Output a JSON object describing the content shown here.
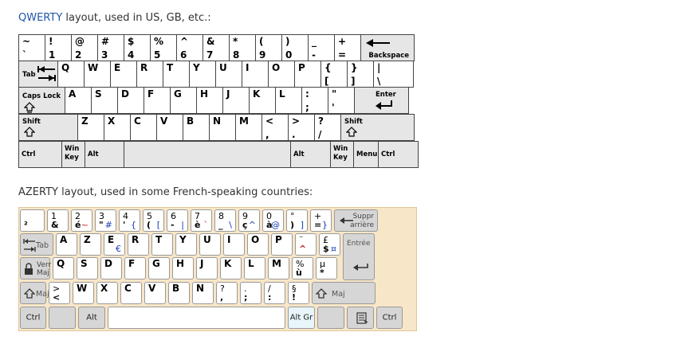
{
  "qwerty": {
    "heading_prefix": "QWERTY",
    "heading_rest": " layout, used in US, GB, etc.:",
    "rows": [
      [
        {
          "top": "~",
          "bottom": "`"
        },
        {
          "top": "!",
          "bottom": "1"
        },
        {
          "top": "@",
          "bottom": "2"
        },
        {
          "top": "#",
          "bottom": "3"
        },
        {
          "top": "$",
          "bottom": "4"
        },
        {
          "top": "%",
          "bottom": "5"
        },
        {
          "top": "^",
          "bottom": "6"
        },
        {
          "top": "&",
          "bottom": "7"
        },
        {
          "top": "*",
          "bottom": "8"
        },
        {
          "top": "(",
          "bottom": "9"
        },
        {
          "top": ")",
          "bottom": "0"
        },
        {
          "top": "_",
          "bottom": "-"
        },
        {
          "top": "+",
          "bottom": "="
        },
        {
          "label": "Backspace"
        }
      ],
      [
        {
          "label": "Tab"
        },
        {
          "main": "Q"
        },
        {
          "main": "W"
        },
        {
          "main": "E"
        },
        {
          "main": "R"
        },
        {
          "main": "T"
        },
        {
          "main": "Y"
        },
        {
          "main": "U"
        },
        {
          "main": "I"
        },
        {
          "main": "O"
        },
        {
          "main": "P"
        },
        {
          "top": "{",
          "bottom": "["
        },
        {
          "top": "}",
          "bottom": "]"
        },
        {
          "top": "|",
          "bottom": "\\"
        }
      ],
      [
        {
          "label": "Caps Lock"
        },
        {
          "main": "A"
        },
        {
          "main": "S"
        },
        {
          "main": "D"
        },
        {
          "main": "F"
        },
        {
          "main": "G"
        },
        {
          "main": "H"
        },
        {
          "main": "J"
        },
        {
          "main": "K"
        },
        {
          "main": "L"
        },
        {
          "top": ":",
          "bottom": ";"
        },
        {
          "top": "\"",
          "bottom": "'"
        },
        {
          "label": "Enter"
        }
      ],
      [
        {
          "label": "Shift"
        },
        {
          "main": "Z"
        },
        {
          "main": "X"
        },
        {
          "main": "C"
        },
        {
          "main": "V"
        },
        {
          "main": "B"
        },
        {
          "main": "N"
        },
        {
          "main": "M"
        },
        {
          "top": "<",
          "bottom": ","
        },
        {
          "top": ">",
          "bottom": "."
        },
        {
          "top": "?",
          "bottom": "/"
        },
        {
          "label": "Shift"
        }
      ],
      [
        {
          "label": "Ctrl"
        },
        {
          "label": "Win Key"
        },
        {
          "label": "Alt"
        },
        {
          "label": ""
        },
        {
          "label": "Alt"
        },
        {
          "label": "Win Key"
        },
        {
          "label": "Menu"
        },
        {
          "label": "Ctrl"
        }
      ]
    ]
  },
  "azerty": {
    "heading": "AZERTY layout, used in some French-speaking countries:",
    "rows": [
      [
        {
          "bl": "²"
        },
        {
          "tl": "1",
          "bl": "&"
        },
        {
          "tl": "2",
          "bl": "é",
          "br": "~"
        },
        {
          "tl": "3",
          "bl": "\"",
          "br": "#"
        },
        {
          "tl": "4",
          "bl": "'",
          "br": "{"
        },
        {
          "tl": "5",
          "bl": "(",
          "br": "["
        },
        {
          "tl": "6",
          "bl": "-",
          "br": "|"
        },
        {
          "tl": "7",
          "bl": "è",
          "br": "`"
        },
        {
          "tl": "8",
          "bl": "_",
          "br": "\\"
        },
        {
          "tl": "9",
          "bl": "ç",
          "br": "^"
        },
        {
          "tl": "0",
          "bl": "à",
          "br": "@"
        },
        {
          "tl": "°",
          "bl": ")",
          "br": "]"
        },
        {
          "tl": "+",
          "bl": "=",
          "br": "}"
        },
        {
          "label": "Suppr\narrière"
        }
      ],
      [
        {
          "label": "Tab"
        },
        {
          "main": "A"
        },
        {
          "main": "Z"
        },
        {
          "main": "E",
          "br": "€"
        },
        {
          "main": "R"
        },
        {
          "main": "T"
        },
        {
          "main": "Y"
        },
        {
          "main": "U"
        },
        {
          "main": "I"
        },
        {
          "main": "O"
        },
        {
          "main": "P"
        },
        {
          "tl": "¨",
          "bl": "^"
        },
        {
          "tl": "£",
          "bl": "$",
          "br": "¤"
        },
        {
          "label": "Entrée"
        }
      ],
      [
        {
          "label": "Verr\nMaj"
        },
        {
          "main": "Q"
        },
        {
          "main": "S"
        },
        {
          "main": "D"
        },
        {
          "main": "F"
        },
        {
          "main": "G"
        },
        {
          "main": "H"
        },
        {
          "main": "J"
        },
        {
          "main": "K"
        },
        {
          "main": "L"
        },
        {
          "main": "M"
        },
        {
          "tl": "%",
          "bl": "ù"
        },
        {
          "tl": "µ",
          "bl": "*"
        }
      ],
      [
        {
          "label": "Maj"
        },
        {
          "tl": ">",
          "bl": "<"
        },
        {
          "main": "W"
        },
        {
          "main": "X"
        },
        {
          "main": "C"
        },
        {
          "main": "V"
        },
        {
          "main": "B"
        },
        {
          "main": "N"
        },
        {
          "tl": "?",
          "bl": ","
        },
        {
          "tl": ".",
          "bl": ";"
        },
        {
          "tl": "/",
          "bl": ":"
        },
        {
          "tl": "§",
          "bl": "!"
        },
        {
          "label": "Maj"
        }
      ],
      [
        {
          "label": "Ctrl"
        },
        {
          "label": ""
        },
        {
          "label": "Alt"
        },
        {
          "label": ""
        },
        {
          "label": "Alt Gr"
        },
        {
          "label": ""
        },
        {
          "label": ""
        },
        {
          "label": "Ctrl"
        }
      ]
    ]
  }
}
